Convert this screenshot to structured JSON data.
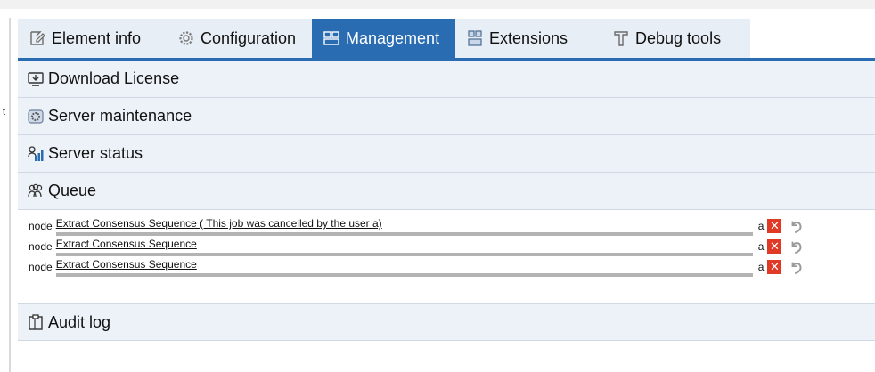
{
  "tabs": [
    {
      "label": "Element info",
      "icon": "document-edit-icon",
      "active": false
    },
    {
      "label": "Configuration",
      "icon": "gear-icon",
      "active": false
    },
    {
      "label": "Management",
      "icon": "management-icon",
      "active": true
    },
    {
      "label": "Extensions",
      "icon": "extensions-icon",
      "active": false
    },
    {
      "label": "Debug tools",
      "icon": "tool-icon",
      "active": false
    }
  ],
  "sections": {
    "download_license": {
      "label": "Download License",
      "icon": "download-monitor-icon"
    },
    "server_maintenance": {
      "label": "Server maintenance",
      "icon": "maintenance-gear-icon"
    },
    "server_status": {
      "label": "Server status",
      "icon": "status-chart-icon"
    },
    "queue": {
      "label": "Queue",
      "icon": "queue-people-icon"
    },
    "audit_log": {
      "label": "Audit log",
      "icon": "clipboard-icon"
    }
  },
  "queue_items": [
    {
      "node": "node",
      "job": "Extract Consensus Sequence ( This job was cancelled by the user a)",
      "owner": "a"
    },
    {
      "node": "node",
      "job": "Extract Consensus Sequence",
      "owner": "a"
    },
    {
      "node": "node",
      "job": "Extract Consensus Sequence",
      "owner": "a"
    }
  ],
  "queue_actions": {
    "cancel_glyph": "✕"
  },
  "stray_text": "t",
  "colors": {
    "accent": "#2a6cb2",
    "tab_bg": "#e8eef6",
    "section_bg": "#edf2f9",
    "cancel_red": "#e03a26",
    "progress_gray": "#b3b3b3"
  }
}
